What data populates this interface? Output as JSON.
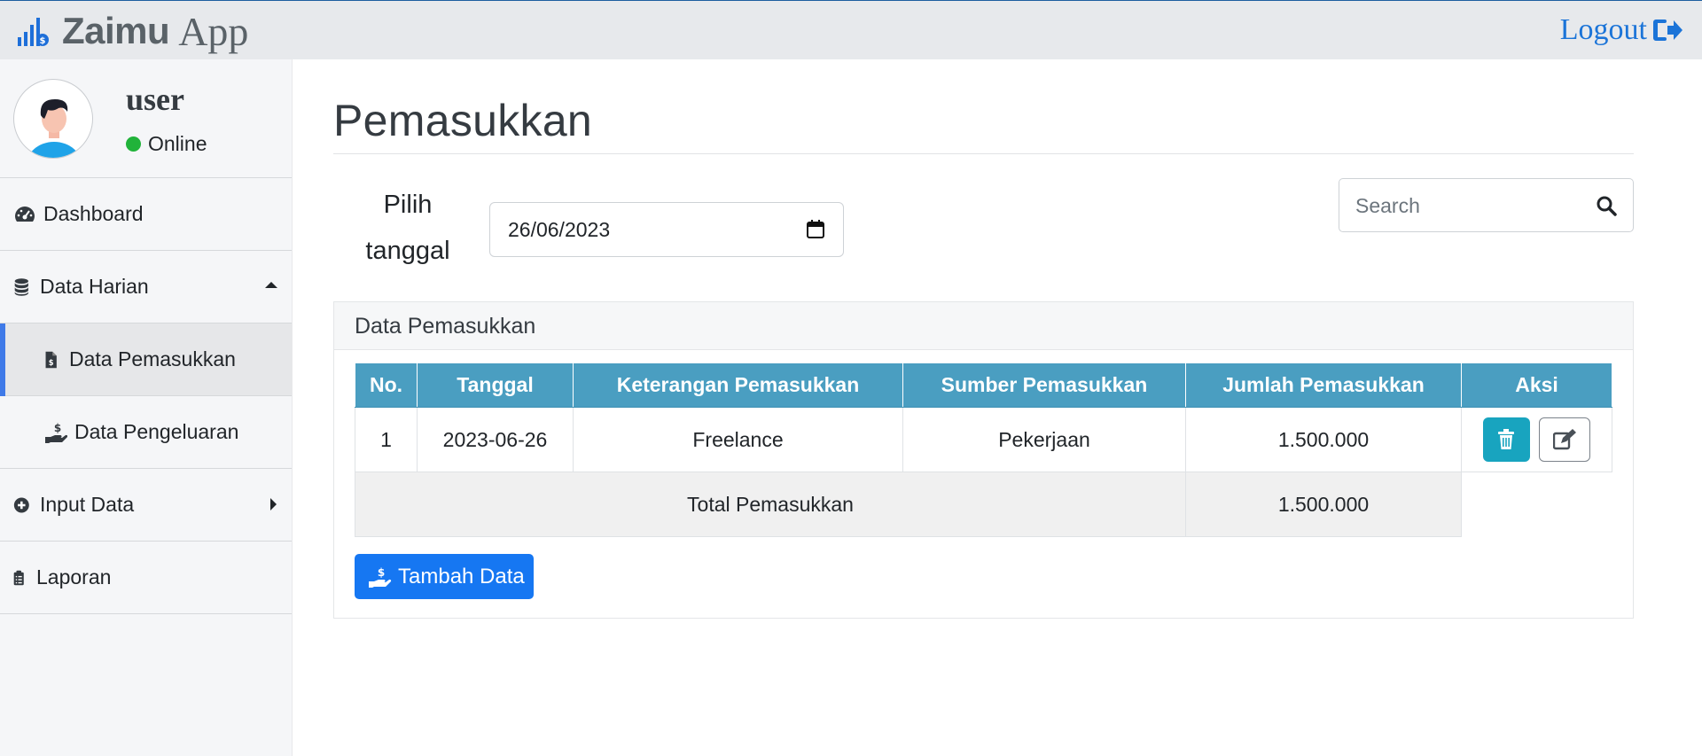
{
  "app": {
    "brand_strong": "Zaimu",
    "brand_light": "App"
  },
  "header": {
    "logout_label": "Logout"
  },
  "user": {
    "name": "user",
    "status": "Online"
  },
  "sidebar": {
    "items": [
      {
        "label": "Dashboard",
        "icon": "tachometer-icon"
      },
      {
        "label": "Data Harian",
        "icon": "database-icon",
        "expanded": true
      },
      {
        "label": "Data Pemasukkan",
        "icon": "file-invoice-dollar-icon",
        "active": true
      },
      {
        "label": "Data Pengeluaran",
        "icon": "hand-holding-usd-icon"
      },
      {
        "label": "Input Data",
        "icon": "plus-circle-icon"
      },
      {
        "label": "Laporan",
        "icon": "clipboard-list-icon"
      }
    ]
  },
  "main": {
    "title": "Pemasukkan",
    "date_label_line1": "Pilih",
    "date_label_line2": "tanggal",
    "date_value": "26/06/2023",
    "search_placeholder": "Search",
    "card_title": "Data Pemasukkan",
    "table": {
      "headers": [
        "No.",
        "Tanggal",
        "Keterangan Pemasukkan",
        "Sumber Pemasukkan",
        "Jumlah Pemasukkan",
        "Aksi"
      ],
      "rows": [
        {
          "no": "1",
          "tanggal": "2023-06-26",
          "keterangan": "Freelance",
          "sumber": "Pekerjaan",
          "jumlah": "1.500.000"
        }
      ],
      "total_label": "Total Pemasukkan",
      "total_value": "1.500.000"
    },
    "add_button_label": "Tambah Data"
  },
  "colors": {
    "accent": "#1677f2",
    "table_header": "#4a9ec1",
    "delete_button": "#18a4bf",
    "status_online": "#21b33a",
    "logout": "#1b74d8"
  }
}
